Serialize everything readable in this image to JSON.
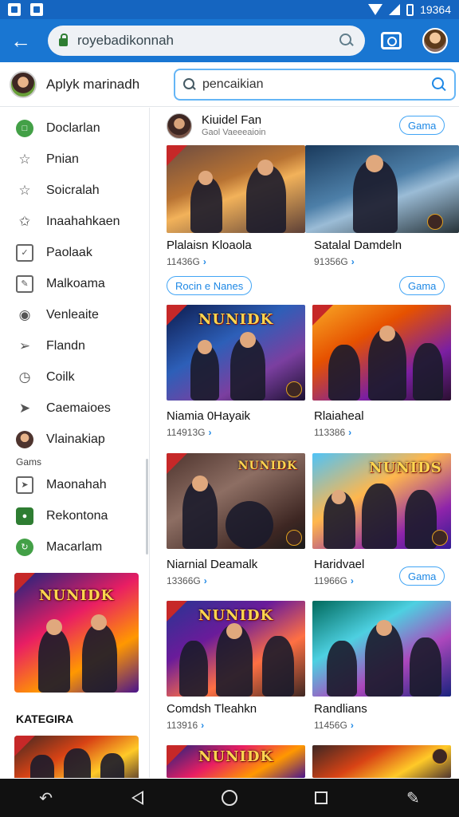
{
  "status_bar": {
    "time": "19364"
  },
  "browser": {
    "url": "royebadikonnah"
  },
  "header": {
    "title": "Aplyk marinadh",
    "search_value": "pencaikian"
  },
  "sidebar": {
    "items": [
      {
        "label": "Doclarlan",
        "icon": "chat-bubble-icon"
      },
      {
        "label": "Pnian",
        "icon": "star-outline-icon"
      },
      {
        "label": "Soicralah",
        "icon": "star-outline-icon"
      },
      {
        "label": "Inaahahkaen",
        "icon": "bookmark-star-icon"
      },
      {
        "label": "Paolaak",
        "icon": "tablet-check-icon"
      },
      {
        "label": "Malkoama",
        "icon": "edit-square-icon"
      },
      {
        "label": "Venleaite",
        "icon": "location-pin-icon"
      },
      {
        "label": "Flandn",
        "icon": "pin-icon"
      },
      {
        "label": "Coilk",
        "icon": "clock-icon"
      },
      {
        "label": "Caemaioes",
        "icon": "compass-icon"
      },
      {
        "label": "Vlainakiap",
        "icon": "avatar-icon"
      }
    ],
    "section_label": "Gams",
    "section_items": [
      {
        "label": "Maonahah",
        "icon": "gamepad-icon"
      },
      {
        "label": "Rekontona",
        "icon": "store-icon"
      },
      {
        "label": "Macarlam",
        "icon": "refresh-icon"
      }
    ],
    "banner_logo": "NUNIDK",
    "kategori_label": "KATEGIRA"
  },
  "featured": {
    "title": "Kiuidel Fan",
    "subtitle": "Gaol Vaeeeaioin",
    "button": "Gama"
  },
  "row_pills": {
    "left": "Rocin e Nanes",
    "right": "Gama",
    "third": "Gama"
  },
  "cards": [
    {
      "title": "Plalaisn Kloaola",
      "meta": "11436G",
      "logo": ""
    },
    {
      "title": "Satalal Damdeln",
      "meta": "91356G",
      "logo": ""
    },
    {
      "title": "Niamia 0Hayaik",
      "meta": "114913G",
      "logo": "NUNIDK"
    },
    {
      "title": "Rlaiaheal",
      "meta": "113386",
      "logo": ""
    },
    {
      "title": "Niarnial Deamalk",
      "meta": "13366G",
      "logo": "NUNIDK"
    },
    {
      "title": "Haridvael",
      "meta": "11966G",
      "logo": "NUNIDS"
    },
    {
      "title": "Comdsh Tleahkn",
      "meta": "113916",
      "logo": "NUNIDK"
    },
    {
      "title": "Randlians",
      "meta": "11456G",
      "logo": ""
    },
    {
      "title": "",
      "meta": "",
      "logo": "NUNIDK"
    },
    {
      "title": "",
      "meta": "",
      "logo": ""
    }
  ],
  "colors": {
    "primary": "#1976d2",
    "status": "#1565c0",
    "accent": "#42a5f5",
    "nav": "#111111"
  }
}
